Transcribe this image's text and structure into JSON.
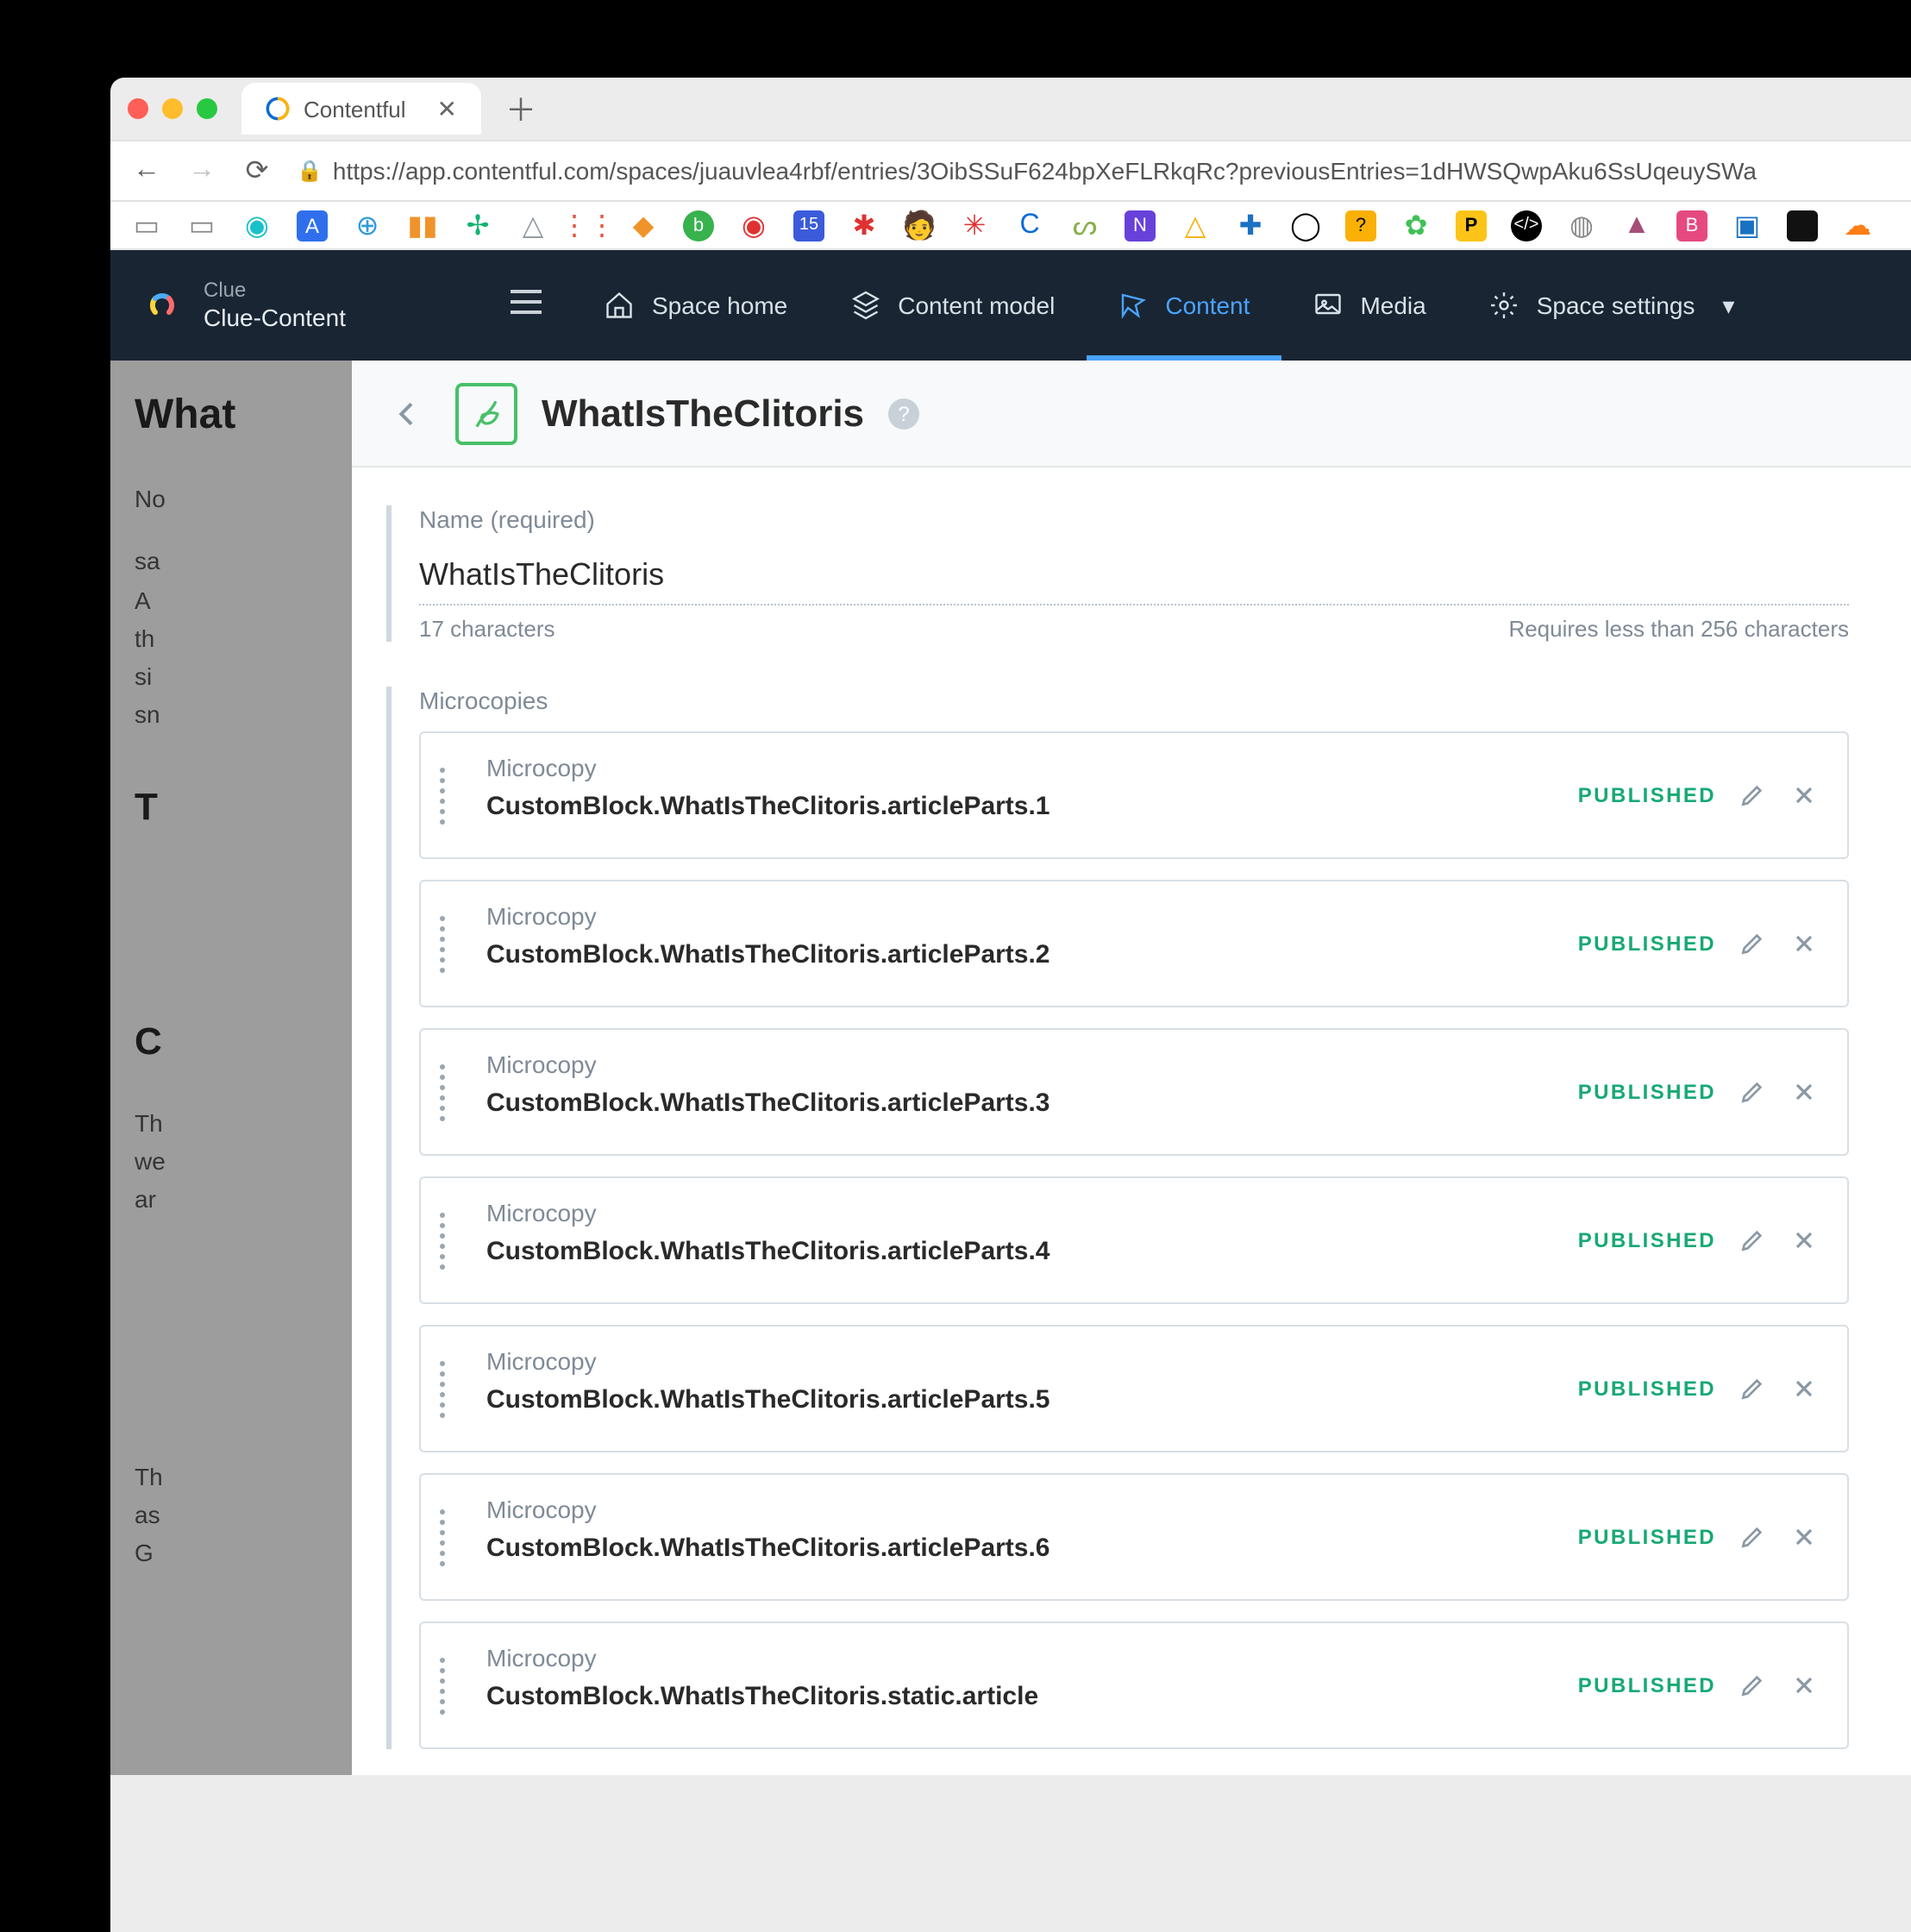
{
  "browser": {
    "tab_title": "Contentful",
    "url": "https://app.contentful.com/spaces/juauvlea4rbf/entries/3OibSSuF624bpXeFLRkqRc?previousEntries=1dHWSQwpAku6SsUqeuySWa"
  },
  "app": {
    "org": "Clue",
    "space": "Clue-Content",
    "nav": [
      "Space home",
      "Content model",
      "Content",
      "Media",
      "Space settings"
    ]
  },
  "background": {
    "heading": "What",
    "l0": "No",
    "l1": "sa",
    "l2": "A",
    "l3": "th",
    "l4": "si",
    "l5": "sn",
    "h2": "T",
    "h3": "C",
    "l6": "Th",
    "l7": "we",
    "l8": "ar",
    "l9": "Th",
    "l10": "as",
    "l11": "G"
  },
  "entry": {
    "title": "WhatIsTheClitoris",
    "name_field": {
      "label": "Name (required)",
      "value": "WhatIsTheClitoris",
      "char_count": "17 characters",
      "limit_text": "Requires less than 256 characters"
    },
    "microcopies": {
      "label": "Microcopies",
      "type_label": "Microcopy",
      "status_label": "PUBLISHED",
      "items": [
        {
          "key": "CustomBlock.WhatIsTheClitoris.articleParts.1"
        },
        {
          "key": "CustomBlock.WhatIsTheClitoris.articleParts.2"
        },
        {
          "key": "CustomBlock.WhatIsTheClitoris.articleParts.3"
        },
        {
          "key": "CustomBlock.WhatIsTheClitoris.articleParts.4"
        },
        {
          "key": "CustomBlock.WhatIsTheClitoris.articleParts.5"
        },
        {
          "key": "CustomBlock.WhatIsTheClitoris.articleParts.6"
        },
        {
          "key": "CustomBlock.WhatIsTheClitoris.static.article"
        }
      ]
    }
  }
}
